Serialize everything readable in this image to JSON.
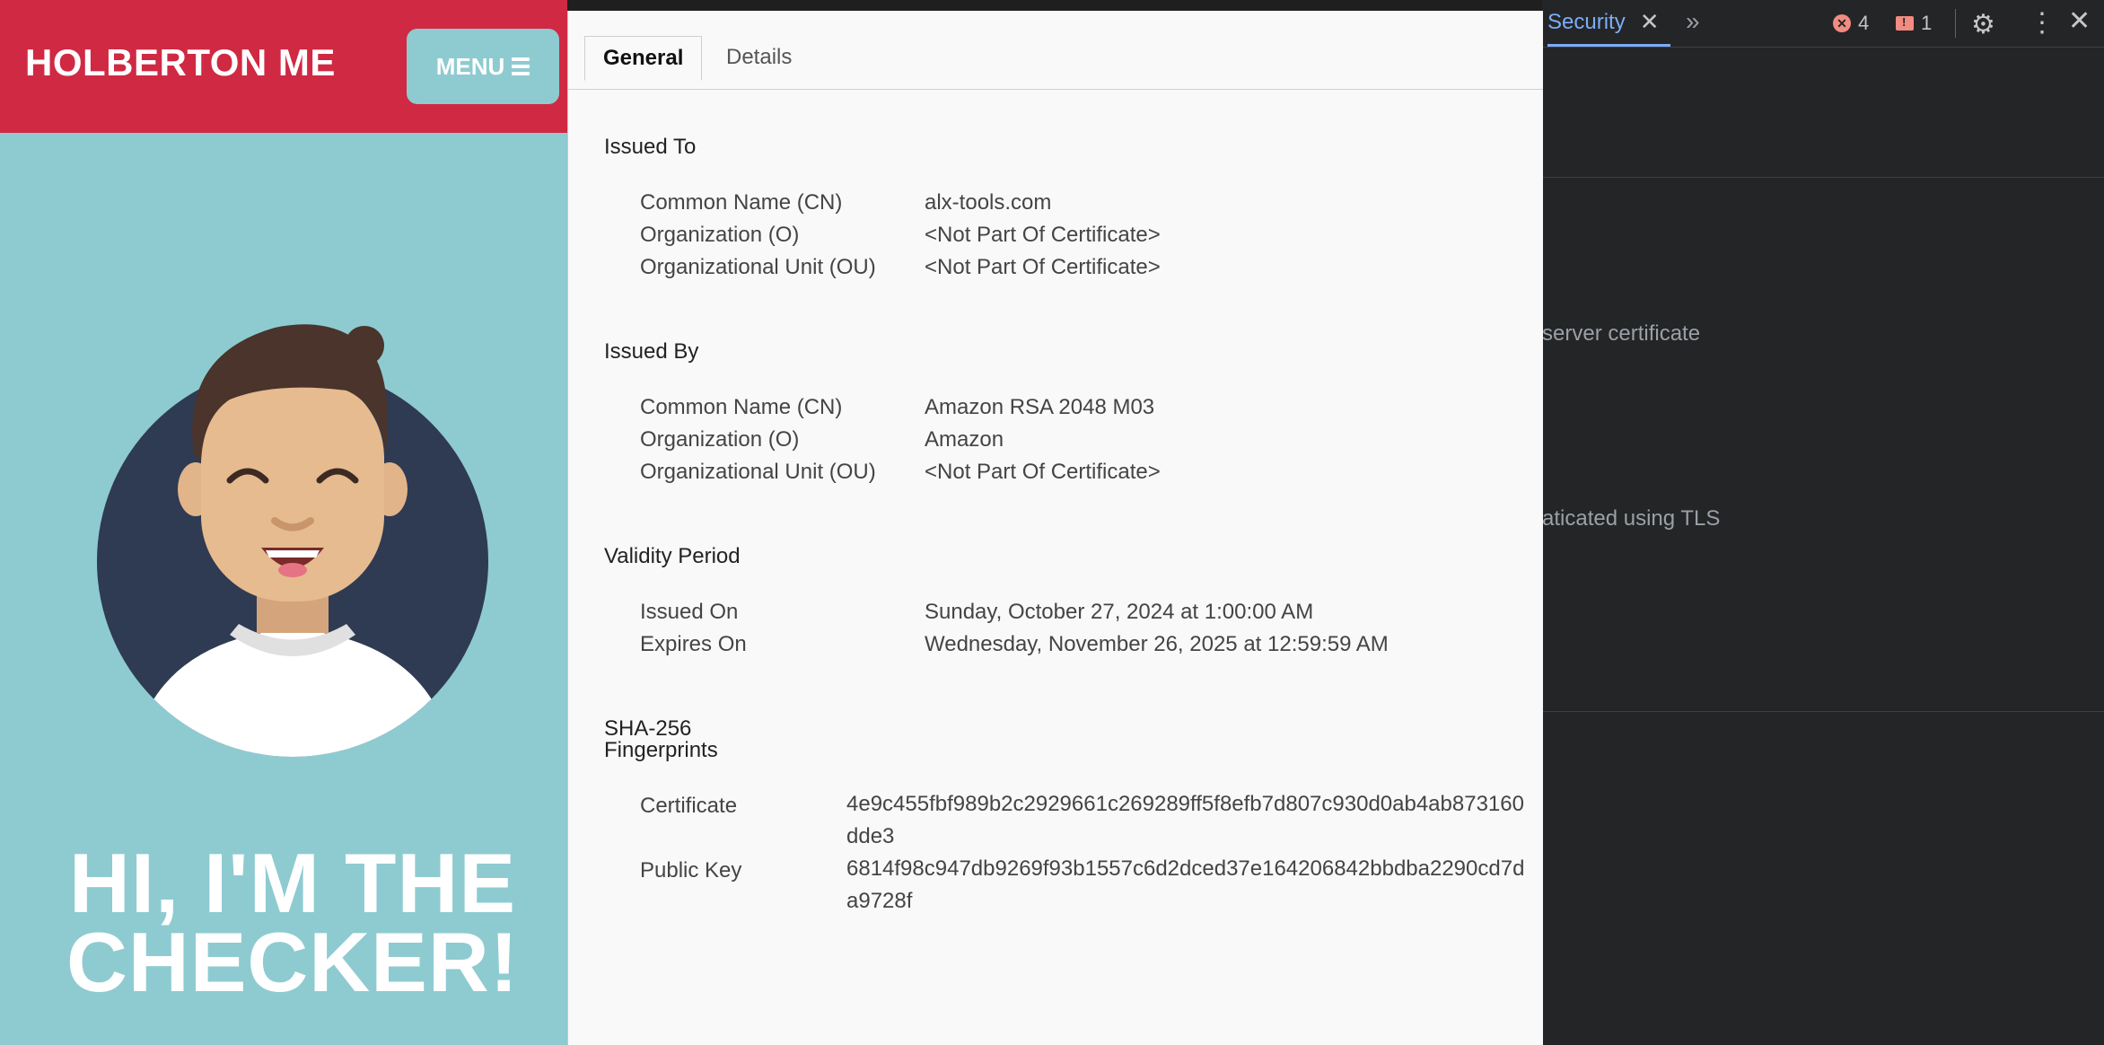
{
  "site": {
    "brand": "HOLBERTON ME",
    "menu_label": "MENU",
    "hero_line1": "HI, I'M THE",
    "hero_line2": "CHECKER!",
    "colors": {
      "header": "#d02943",
      "background": "#8ecbd1"
    }
  },
  "dialog": {
    "tabs": [
      "General",
      "Details"
    ],
    "issued_to": {
      "title": "Issued To",
      "rows": [
        {
          "label": "Common Name (CN)",
          "value": "alx-tools.com"
        },
        {
          "label": "Organization (O)",
          "value": "<Not Part Of Certificate>"
        },
        {
          "label": "Organizational Unit (OU)",
          "value": "<Not Part Of Certificate>"
        }
      ]
    },
    "issued_by": {
      "title": "Issued By",
      "rows": [
        {
          "label": "Common Name (CN)",
          "value": "Amazon RSA 2048 M03"
        },
        {
          "label": "Organization (O)",
          "value": "Amazon"
        },
        {
          "label": "Organizational Unit (OU)",
          "value": "<Not Part Of Certificate>"
        }
      ]
    },
    "validity": {
      "title": "Validity Period",
      "rows": [
        {
          "label": "Issued On",
          "value": "Sunday, October 27, 2024 at 1:00:00 AM"
        },
        {
          "label": "Expires On",
          "value": "Wednesday, November 26, 2025 at 12:59:59 AM"
        }
      ]
    },
    "fingerprints": {
      "title_line1": "SHA-256",
      "title_line2": "Fingerprints",
      "rows": [
        {
          "label": "Certificate",
          "value": "4e9c455fbf989b2c2929661c269289ff5f8efb7d807c930d0ab4ab873160dde3"
        },
        {
          "label": "Public Key",
          "value": "6814f98c947db9269f93b1557c6d2dced37e164206842bbdba2290cd7da9728f"
        }
      ]
    }
  },
  "devtools": {
    "active_tab": "Security",
    "error_count": "4",
    "warning_count": "1",
    "partial_text_1": "server certificate",
    "partial_text_2": "aticated using TLS",
    "icons": [
      "close-icon",
      "chevron-double-right-icon",
      "error-icon",
      "issue-icon",
      "gear-icon",
      "kebab-icon",
      "close-icon"
    ]
  }
}
